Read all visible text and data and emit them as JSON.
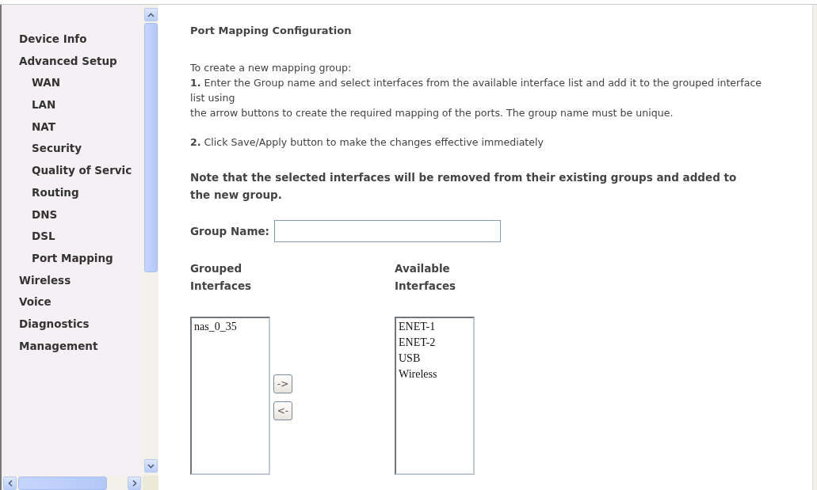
{
  "sidebar": {
    "items": [
      {
        "label": "Device Info"
      },
      {
        "label": "Advanced Setup",
        "children": [
          {
            "label": "WAN"
          },
          {
            "label": "LAN"
          },
          {
            "label": "NAT"
          },
          {
            "label": "Security"
          },
          {
            "label": "Quality of Servic"
          },
          {
            "label": "Routing"
          },
          {
            "label": "DNS"
          },
          {
            "label": "DSL"
          },
          {
            "label": "Port Mapping"
          }
        ]
      },
      {
        "label": "Wireless"
      },
      {
        "label": "Voice"
      },
      {
        "label": "Diagnostics"
      },
      {
        "label": "Management"
      }
    ]
  },
  "content": {
    "title": "Port Mapping Configuration",
    "intro": "To create a new mapping group:",
    "step_1": [
      "**1.** Enter the Group name and select interfaces from the available interface list and add it to the grouped interface list using",
      "the arrow buttons to create the required mapping of the ports. The group name must be unique."
    ],
    "step_2": "**2.** Click Save/Apply button to make the changes effective immediately",
    "note": "Note that the selected interfaces will be removed from their existing groups and added to the new group.",
    "group_name": {
      "label": "Group Name:"
    },
    "grouped_interfaces": {
      "heading": "Grouped Interfaces",
      "items": [
        "nas_0_35"
      ]
    },
    "available_interfaces": {
      "heading": "Available Interfaces",
      "items": [
        "ENET-1",
        "ENET-2",
        "USB",
        "Wireless"
      ]
    },
    "move_buttons": [
      "->",
      "<-"
    ]
  }
}
